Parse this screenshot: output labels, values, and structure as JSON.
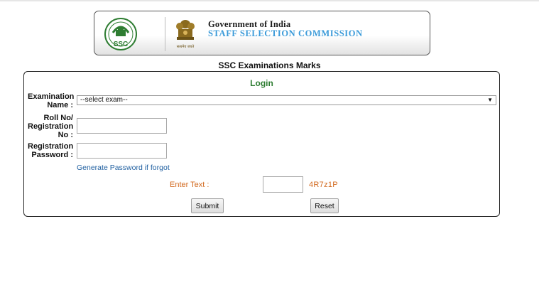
{
  "header": {
    "gov_title": "Government of India",
    "commission_title": "STAFF SELECTION COMMISSION",
    "logo_text": "SSC",
    "emblem_caption": "सत्यमेव जयते"
  },
  "page_heading": "SSC Examinations Marks",
  "login": {
    "title": "Login",
    "exam_label_line1": "Examination",
    "exam_label_line2": "Name :",
    "exam_selected": "--select exam--",
    "roll_label_line1": "Roll No/",
    "roll_label_line2": "Registration",
    "roll_label_line3": "No :",
    "roll_value": "",
    "password_label_line1": "Registration",
    "password_label_line2": "Password :",
    "password_value": "",
    "forgot_link": "Generate Password if forgot",
    "captcha_label": "Enter Text :",
    "captcha_value": "",
    "captcha_code": "4R7z1P",
    "submit_label": "Submit",
    "reset_label": "Reset"
  },
  "colors": {
    "login_title": "#2e7d32",
    "commission_title": "#3a9ad9",
    "captcha_text": "#d2691e",
    "link": "#1f5fa0"
  }
}
